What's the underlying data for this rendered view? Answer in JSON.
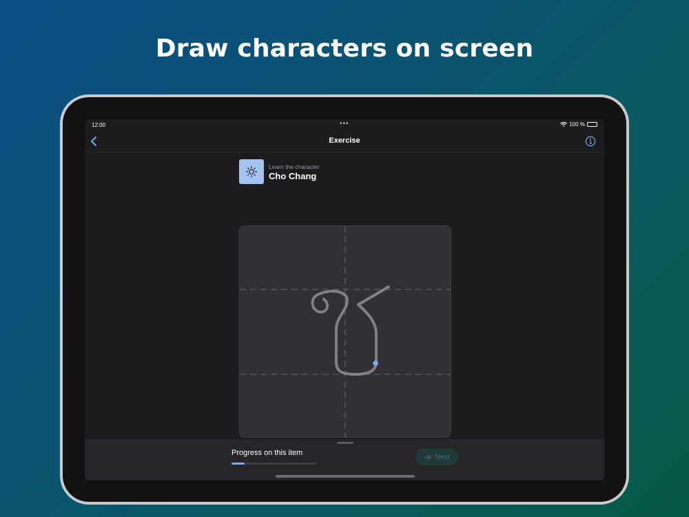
{
  "headline": "Draw characters on screen",
  "status": {
    "time": "12:00",
    "battery_label": "100 %",
    "battery_level": 1.0
  },
  "nav": {
    "title": "Exercise",
    "back_icon": "chevron-left-icon",
    "info_icon": "info-circle-icon"
  },
  "character": {
    "subtitle": "Learn the character",
    "name": "Cho Chang",
    "icon": "sun-icon",
    "icon_bg": "#a4c3f1"
  },
  "progress": {
    "label": "Progress on this item",
    "value": 0.15,
    "color": "#7ea9ee"
  },
  "next_button": {
    "label": "Next",
    "icon": "arrow-right-icon",
    "enabled": false
  },
  "colors": {
    "accent": "#7ea9ee",
    "screen_bg": "#1c1c1e",
    "canvas_bg": "#303035"
  }
}
